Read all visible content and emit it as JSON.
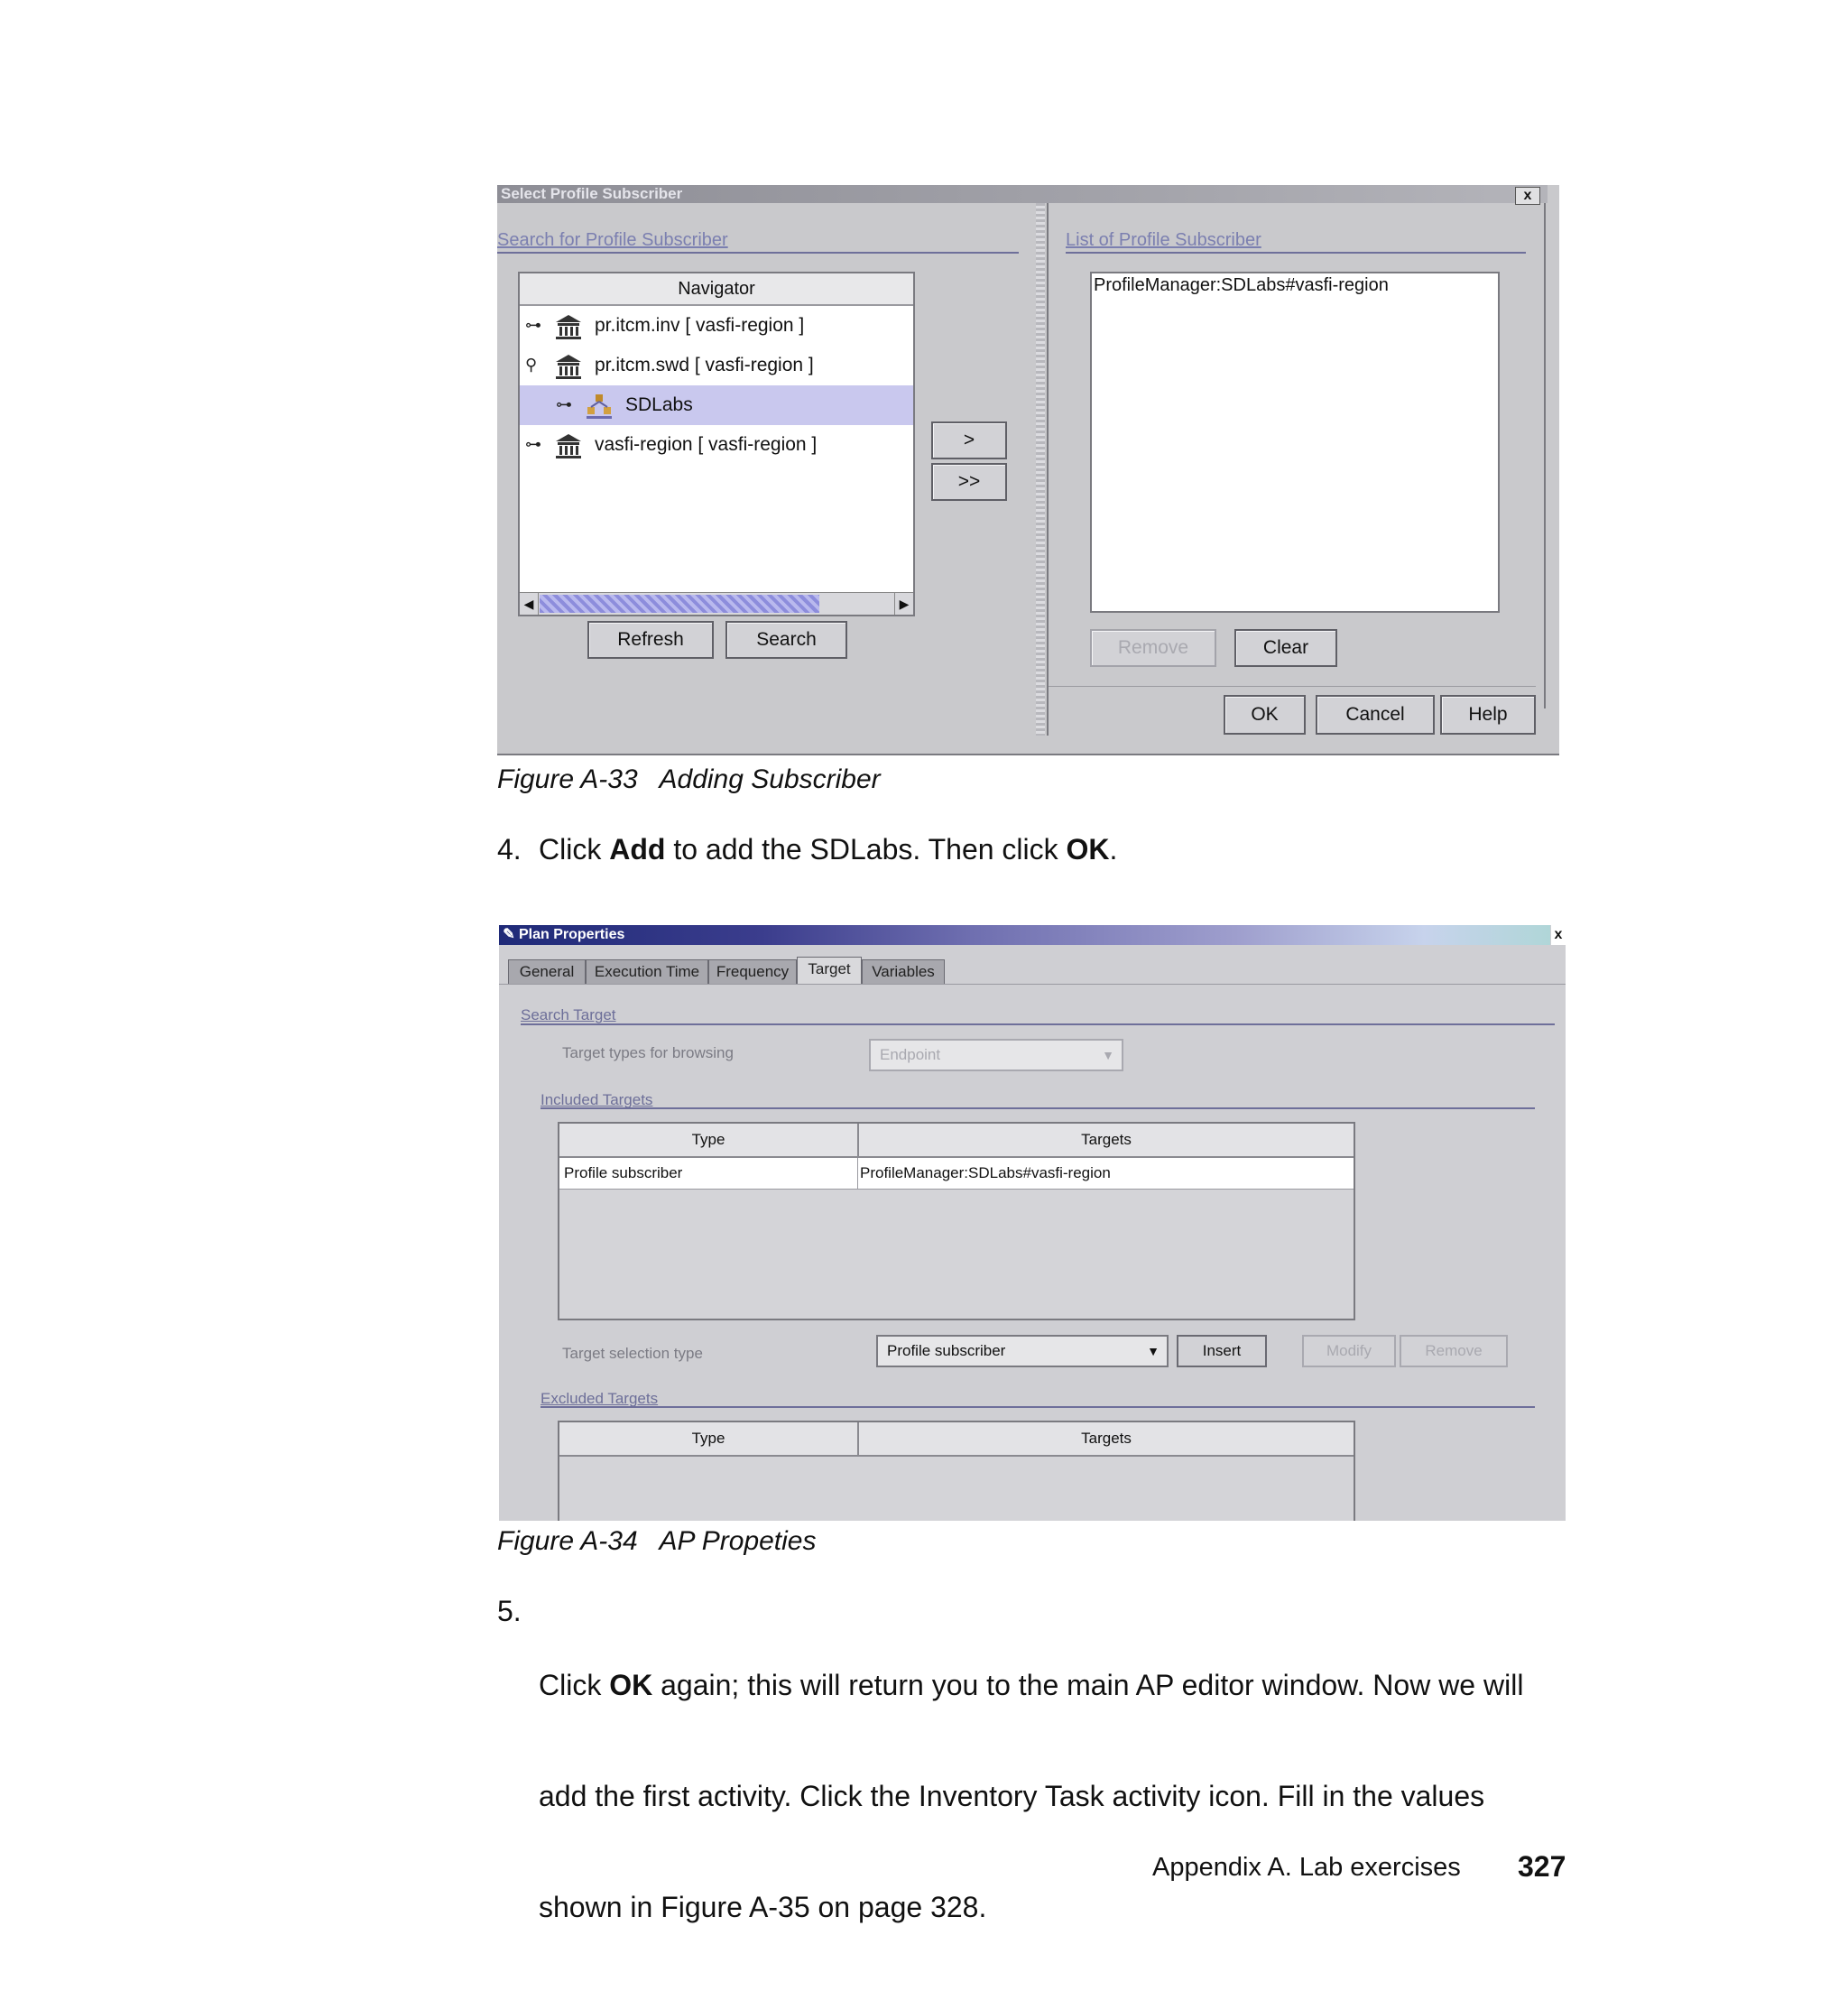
{
  "figure33": {
    "dialog_title": "Select Profile Subscriber",
    "close_glyph": "x",
    "search_group": "Search for Profile Subscriber",
    "list_group": "List of Profile Subscriber",
    "navigator_header": "Navigator",
    "tree": [
      {
        "toggle": "⊶",
        "icon": "region-icon",
        "label": "pr.itcm.inv [ vasfi-region ]"
      },
      {
        "toggle": "⚲",
        "icon": "region-icon",
        "label": "pr.itcm.swd [ vasfi-region ]"
      },
      {
        "toggle": "⊶",
        "icon": "profile-manager-icon",
        "label": "SDLabs",
        "selected": true
      },
      {
        "toggle": "⊶",
        "icon": "region-icon",
        "label": "vasfi-region [ vasfi-region ]"
      }
    ],
    "add_button": ">",
    "add_all_button": ">>",
    "refresh_button": "Refresh",
    "search_button": "Search",
    "list_items": [
      "ProfileManager:SDLabs#vasfi-region"
    ],
    "remove_button": "Remove",
    "clear_button": "Clear",
    "ok_button": "OK",
    "cancel_button": "Cancel",
    "help_button": "Help"
  },
  "caption33": "Figure A-33   Adding Subscriber",
  "step4": {
    "num": "4.",
    "t1": "Click ",
    "b1": "Add",
    "t2": " to add the SDLabs. Then click ",
    "b2": "OK",
    "t3": "."
  },
  "figure34": {
    "window_title": "Plan Properties",
    "close_glyph": "x",
    "tabs": [
      "General",
      "Execution Time",
      "Frequency",
      "Target",
      "Variables"
    ],
    "active_tab": "Target",
    "search_target_group": "Search Target",
    "target_types_label": "Target types for browsing",
    "target_types_value": "Endpoint",
    "included_group": "Included Targets",
    "col_type": "Type",
    "col_targets": "Targets",
    "included_rows": [
      {
        "type": "Profile subscriber",
        "targets": "ProfileManager:SDLabs#vasfi-region"
      }
    ],
    "selection_type_label": "Target selection type",
    "selection_type_value": "Profile subscriber",
    "insert_button": "Insert",
    "modify_button": "Modify",
    "remove_button": "Remove",
    "excluded_group": "Excluded Targets"
  },
  "caption34": "Figure A-34   AP Propeties",
  "step5": {
    "num": "5.",
    "t1": "Click ",
    "b1": "OK",
    "t2": " again; this will return you to the main AP editor window. Now we will",
    "line2": "add the first activity. Click the Inventory Task activity icon. Fill in the values",
    "line3": "shown in Figure A-35 on page 328."
  },
  "footer": {
    "section": "Appendix A. Lab exercises",
    "page": "327"
  }
}
